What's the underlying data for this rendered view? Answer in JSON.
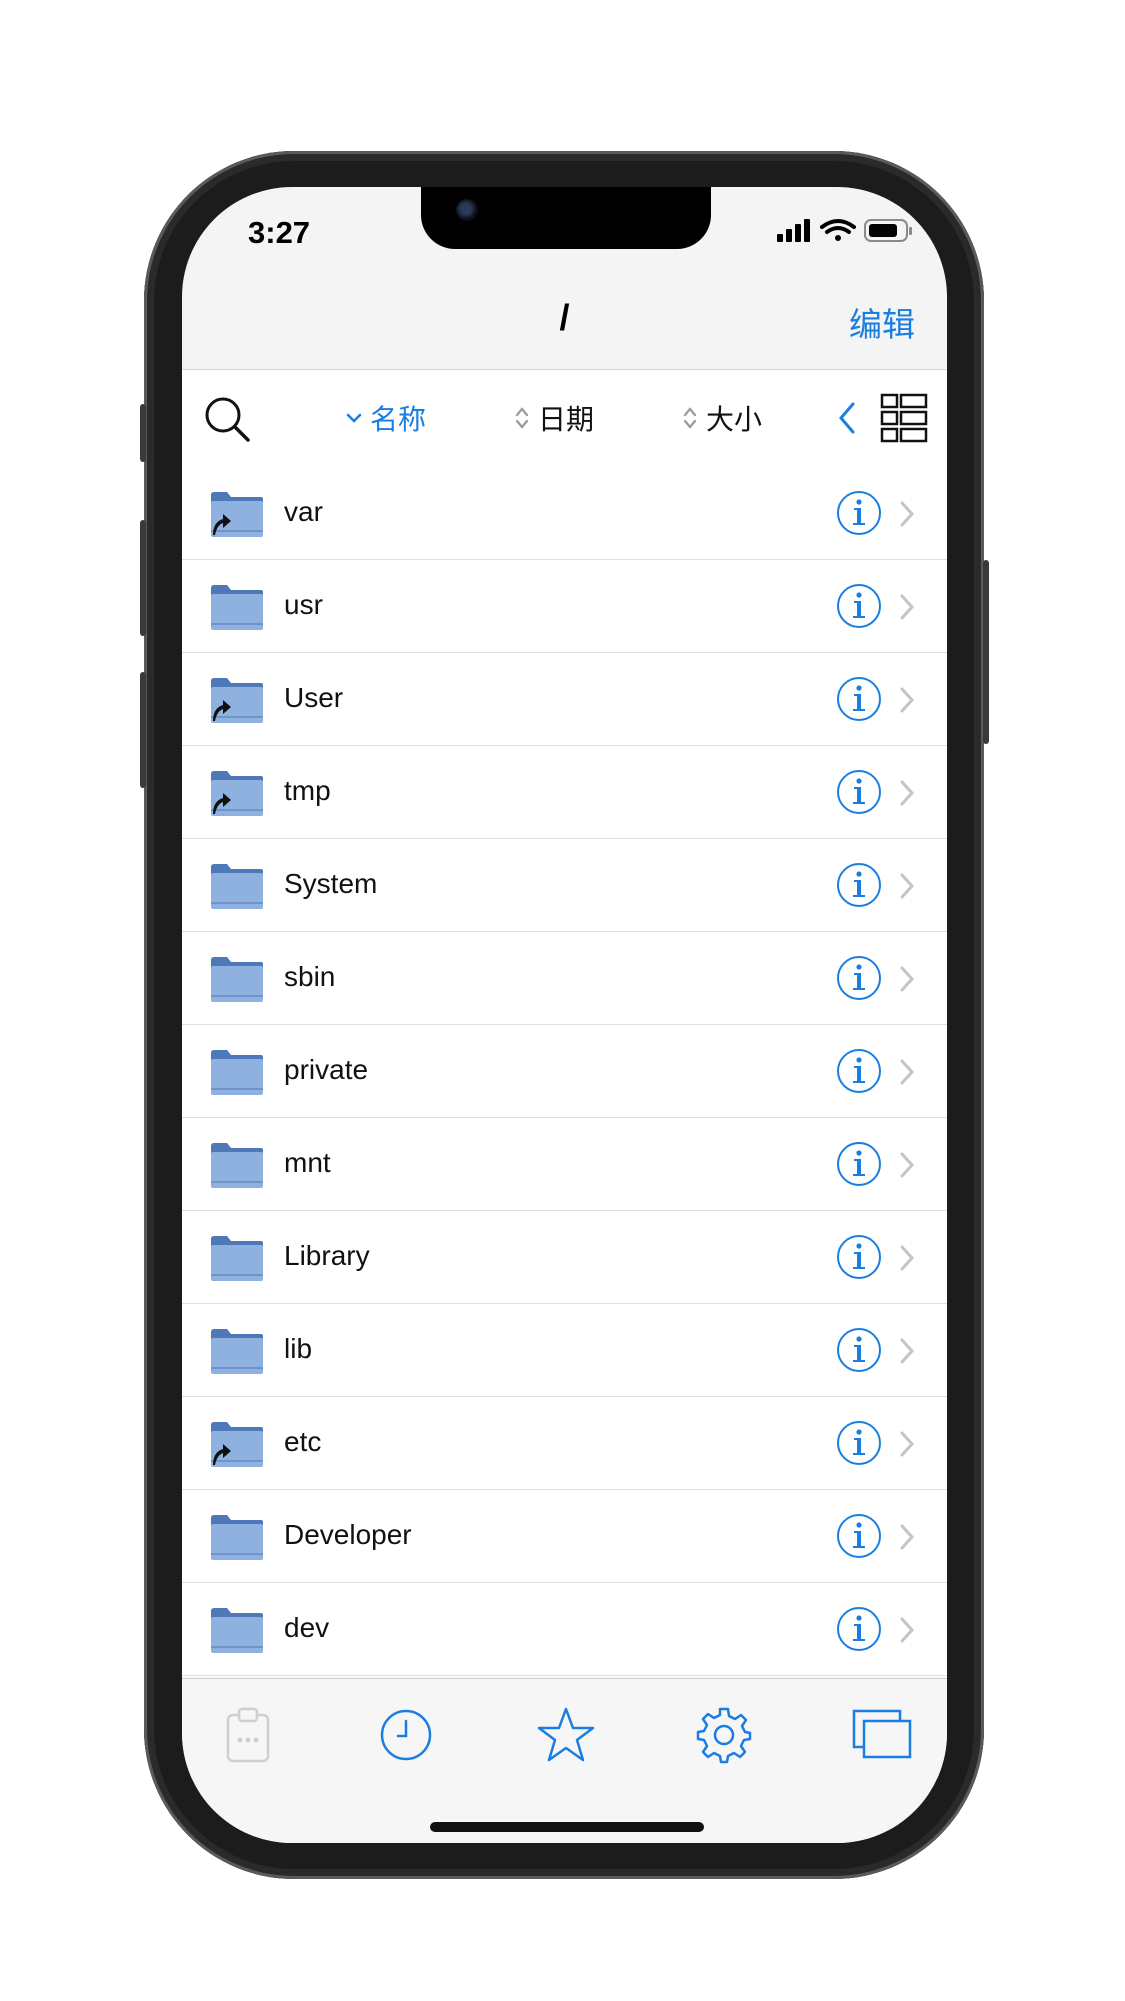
{
  "status_bar": {
    "time": "3:27"
  },
  "nav": {
    "title": "/",
    "edit_label": "编辑"
  },
  "sort": {
    "name_label": "名称",
    "date_label": "日期",
    "size_label": "大小"
  },
  "files": [
    {
      "name": "var",
      "symlink": true
    },
    {
      "name": "usr",
      "symlink": false
    },
    {
      "name": "User",
      "symlink": true
    },
    {
      "name": "tmp",
      "symlink": true
    },
    {
      "name": "System",
      "symlink": false
    },
    {
      "name": "sbin",
      "symlink": false
    },
    {
      "name": "private",
      "symlink": false
    },
    {
      "name": "mnt",
      "symlink": false
    },
    {
      "name": "Library",
      "symlink": false
    },
    {
      "name": "lib",
      "symlink": false
    },
    {
      "name": "etc",
      "symlink": true
    },
    {
      "name": "Developer",
      "symlink": false
    },
    {
      "name": "dev",
      "symlink": false
    }
  ],
  "tabs": [
    {
      "icon": "clipboard-icon",
      "enabled": false
    },
    {
      "icon": "clock-icon",
      "enabled": true
    },
    {
      "icon": "star-icon",
      "enabled": true
    },
    {
      "icon": "gear-icon",
      "enabled": true
    },
    {
      "icon": "windows-icon",
      "enabled": true
    }
  ],
  "colors": {
    "accent": "#1a7ee0",
    "folder": "#8fb1e0",
    "folder_dark": "#4f78b8"
  }
}
